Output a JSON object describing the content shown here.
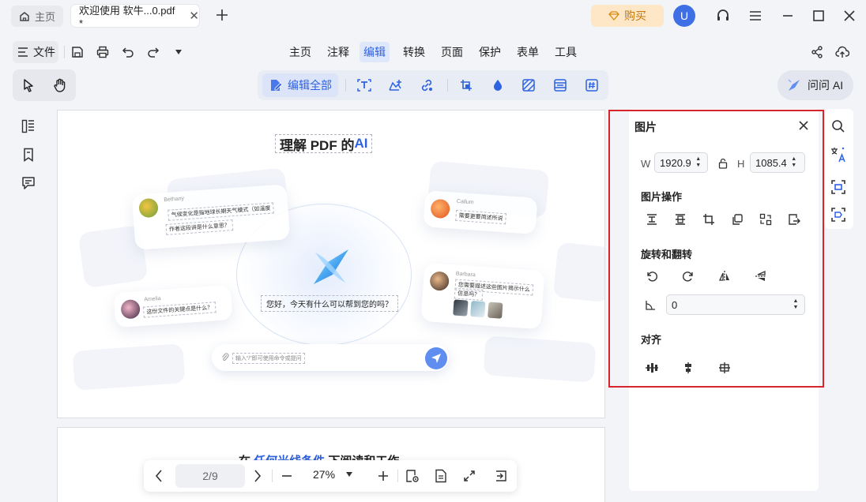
{
  "titlebar": {
    "home_tab": "主页",
    "doc_tab": "欢迎使用 软牛...0.pdf *",
    "buy_label": "购买",
    "avatar_initial": "U",
    "icons": [
      "home-icon",
      "close-tab-icon",
      "add-tab-icon",
      "diamond-icon",
      "headset-icon",
      "hamburger-menu-icon",
      "minimize-icon",
      "maximize-icon",
      "close-window-icon"
    ]
  },
  "menubar": {
    "file_label": "文件",
    "items": [
      "主页",
      "注释",
      "编辑",
      "转换",
      "页面",
      "保护",
      "表单",
      "工具"
    ],
    "active": "编辑"
  },
  "toolbar": {
    "edit_all_label": "编辑全部",
    "ask_ai_label": "问问 AI"
  },
  "document": {
    "title_prefix": "理解 PDF 的 ",
    "title_ai": "AI",
    "chat": {
      "bethany_name": "Bethany",
      "bethany_line1": "气候变化是指地球长期天气模式（如温度",
      "bethany_line2": "作者这段讲是什么意思？",
      "callum_name": "Callum",
      "callum_line": "需要更要简述所说",
      "barbara_name": "Barbara",
      "barbara_line1": "您需要描述这些图片揭示什么",
      "barbara_line2": "信息吗？",
      "amelia_name": "Amelia",
      "amelia_line": "这份文件的关键点是什么？",
      "hello": "您好，今天有什么可以帮到您的吗？",
      "input_placeholder": "输入“/”即可使用命令或提问"
    },
    "page2_prefix": "在",
    "page2_highlight": "任何光线条件",
    "page2_suffix": "下阅读和工作"
  },
  "bottom_nav": {
    "page": "2/9",
    "zoom": "27%"
  },
  "image_panel": {
    "title": "图片",
    "width_label": "W",
    "width_value": "1920.9",
    "height_label": "H",
    "height_value": "1085.4",
    "operations_title": "图片操作",
    "rotate_title": "旋转和翻转",
    "angle_value": "0",
    "align_title": "对齐"
  },
  "colors": {
    "accent": "#2f62e0",
    "highlight_frame": "#d8242b",
    "buy_bg": "#fde7c7",
    "buy_text": "#c7780a"
  }
}
